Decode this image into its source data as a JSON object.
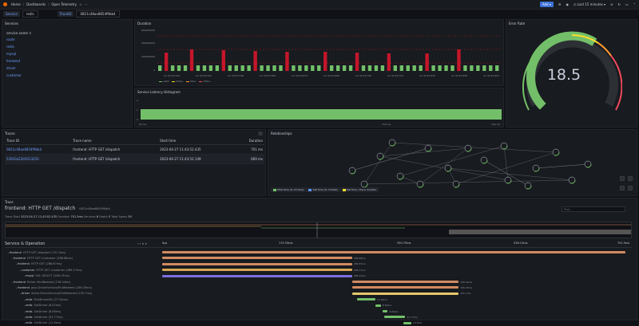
{
  "topbar": {
    "home": "Home",
    "dashboards": "Dashboards",
    "current": "Open Telemetry",
    "add_label": "Add",
    "time_range": "Last 15 minutes"
  },
  "variables": {
    "service_label": "Service",
    "service_value": "redis",
    "traceid_label": "TraceID",
    "traceid_value": "0821c48ae8854f9bb4"
  },
  "services_panel": {
    "title": "Services",
    "header": "service.name",
    "items": [
      "route",
      "redis",
      "mysql",
      "frontend",
      "driver",
      "customer"
    ]
  },
  "duration_panel": {
    "title": "Duration",
    "y_ticks": [
      "600000000",
      "400000000",
      "200000000",
      "0"
    ],
    "x_ticks": [
      "11:43:52.444",
      "11:43:52.501",
      "11:43:52.548",
      "11:43:52.589",
      "11:43:52.613",
      "11:43:52.660",
      "11:43:52.750",
      "11:43:52.791",
      "11:43:52.832",
      "11:43:52.858",
      "11:43:52.901"
    ],
    "legend": [
      "≤20k",
      "500k+",
      "50k+",
      "700k+"
    ],
    "colors": {
      "ok": "#73bf69",
      "slow": "#c4162a"
    }
  },
  "error_panel": {
    "title": "Error Rate",
    "value": "18.5",
    "fill_fraction": 0.62,
    "colors": {
      "green": "#73bf69",
      "yellow": "#fade2a",
      "orange": "#ff9830",
      "red": "#f2495c"
    }
  },
  "histogram_panel": {
    "title": "Service Latency Histogram",
    "y_ticks": [
      "2",
      "1",
      "0"
    ],
    "x_ticks": [
      "60 ms",
      "700 ms",
      "700 ms"
    ]
  },
  "traces_panel": {
    "title": "Traces",
    "columns": [
      "Trace ID",
      "Trace name",
      "Start time",
      "Duration"
    ],
    "rows": [
      {
        "id": "0821c48ae8854f9bb4",
        "name": "frontend: HTTP GET /dispatch",
        "start": "2023-04-27 11:43:52.435",
        "duration": "701 ms"
      },
      {
        "id": "53910a22b5913250",
        "name": "frontend: HTTP GET /dispatch",
        "start": "2023-04-27 11:43:52.149",
        "duration": "669 ms"
      }
    ]
  },
  "relationships_panel": {
    "title": "Relationships",
    "legend": [
      "Total time (% of trace)",
      "Self time (% of total)",
      "Self time / Trace duration"
    ]
  },
  "trace_view": {
    "section": "Trace",
    "title": "frontend: HTTP GET /dispatch",
    "trace_id": "0821c48ae8854f9bb4",
    "meta": {
      "start_label": "Trace Start",
      "start_value": "2023-04-27 11:43:52.435",
      "duration_label": "Duration",
      "duration_value": "701.3ms",
      "services_label": "Services",
      "services_value": "6",
      "depth_label": "Depth",
      "depth_value": "5",
      "spans_label": "Total Spans",
      "spans_value": "50"
    },
    "find_placeholder": "Find...",
    "column_header": "Service & Operation",
    "ticks": [
      "0μs",
      "175.33ms",
      "350.75ms",
      "526.13ms",
      "701.5ms"
    ],
    "spans": [
      {
        "service": "frontend",
        "op": "HTTP GET /dispatch (701.3ms)",
        "indent": 0,
        "start": 0.0,
        "len": 1.0,
        "color": "#d28a61",
        "label": ""
      },
      {
        "service": "frontend",
        "op": "HTTP GET /customer (286.68ms)",
        "indent": 1,
        "start": 0.0,
        "len": 0.41,
        "color": "#d28a61",
        "label": "286.68ms"
      },
      {
        "service": "frontend",
        "op": "HTTP GET (286.67ms)",
        "indent": 2,
        "start": 0.0,
        "len": 0.41,
        "color": "#d28a61",
        "label": "286.67ms"
      },
      {
        "service": "customer",
        "op": "HTTP GET /customer (286.17ms)",
        "indent": 3,
        "start": 0.0,
        "len": 0.41,
        "color": "#d8a556",
        "label": "286.17ms"
      },
      {
        "service": "mysql",
        "op": "SQL SELECT (286.13ms)",
        "indent": 4,
        "start": 0.0,
        "len": 0.41,
        "color": "#7b6fe0",
        "label": "286.13ms"
      },
      {
        "service": "frontend",
        "op": "Driver::findNearest (156.44ms)",
        "indent": 1,
        "start": 0.41,
        "len": 0.23,
        "color": "#d28a61",
        "label": "156.44ms"
      },
      {
        "service": "frontend",
        "op": "grpc.DriverService/FindNearest (156.35ms)",
        "indent": 2,
        "start": 0.41,
        "len": 0.23,
        "color": "#d28a61",
        "label": "156.35ms"
      },
      {
        "service": "driver",
        "op": "driver.DriverService/FindNearest (155.7ms)",
        "indent": 3,
        "start": 0.41,
        "len": 0.23,
        "color": "#e5c86a",
        "label": "155.7ms"
      },
      {
        "service": "redis",
        "op": "FindDriverIDs (27.54ms)",
        "indent": 4,
        "start": 0.42,
        "len": 0.04,
        "color": "#73bf69",
        "label": "27.54ms"
      },
      {
        "service": "redis",
        "op": "GetDriver (8.52ms)",
        "indent": 4,
        "start": 0.46,
        "len": 0.012,
        "color": "#73bf69",
        "label": "8.52ms"
      },
      {
        "service": "redis",
        "op": "GetDriver (8.06ms)",
        "indent": 4,
        "start": 0.475,
        "len": 0.012,
        "color": "#73bf69",
        "label": "8.06ms"
      },
      {
        "service": "redis",
        "op": "GetDriver (31.77ms)",
        "indent": 4,
        "start": 0.48,
        "len": 0.045,
        "color": "#73bf69",
        "label": "31.77ms"
      },
      {
        "service": "redis",
        "op": "GetDriver (12.6ms)",
        "indent": 4,
        "start": 0.52,
        "len": 0.018,
        "color": "#73bf69",
        "label": "12.6ms"
      }
    ]
  }
}
